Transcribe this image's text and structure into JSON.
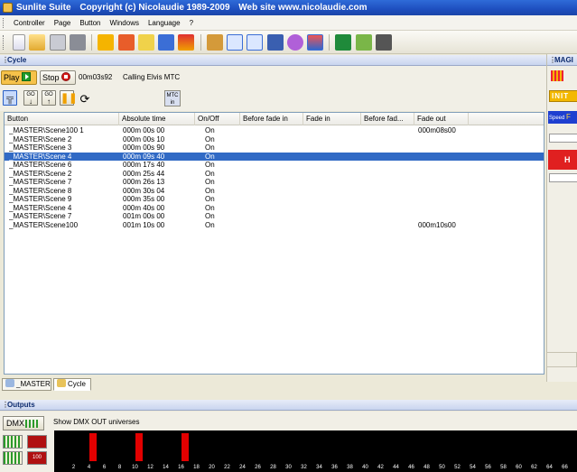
{
  "window": {
    "app_name": "Sunlite Suite",
    "copyright": "Copyright (c) Nicolaudie 1989-2009",
    "website": "Web site www.nicolaudie.com"
  },
  "menu": [
    "Controller",
    "Page",
    "Button",
    "Windows",
    "Language",
    "?"
  ],
  "toolbar_icons": [
    "new-icon",
    "open-icon",
    "save-icon",
    "delete-icon",
    "scene-icon",
    "switch-icon",
    "cycle-icon",
    "bus-icon",
    "color-icon",
    "live-icon",
    "easy-stand-icon",
    "easy-step-icon",
    "monitor-icon",
    "3d-icon",
    "midi-icon",
    "panel-icon",
    "music-icon",
    "tools-icon"
  ],
  "cycle_panel": {
    "title": "Cycle",
    "play_label": "Play",
    "stop_label": "Stop",
    "time": "00m03s92",
    "status": "Calling Elvis MTC",
    "mtc_line1": "MTC",
    "mtc_line2": "in",
    "go_label_1": "GO",
    "go_label_2": "GO"
  },
  "right_panel": {
    "title": "MAGI",
    "init_label": "INIT",
    "speed_label": "Speed",
    "f_label": "F",
    "h_label": "H"
  },
  "table": {
    "columns": [
      "Button",
      "Absolute time",
      "On/Off",
      "Before fade in",
      "Fade in",
      "Before fad...",
      "Fade out"
    ],
    "rows": [
      [
        "_MASTER\\Scene100 1",
        "000m 00s 00",
        "On",
        "",
        "",
        "",
        "000m08s00"
      ],
      [
        "_MASTER\\Scene 2",
        "000m 00s 10",
        "On",
        "",
        "",
        "",
        ""
      ],
      [
        "_MASTER\\Scene 3",
        "000m 00s 90",
        "On",
        "",
        "",
        "",
        ""
      ],
      [
        "_MASTER\\Scene 4",
        "000m 09s 40",
        "On",
        "",
        "",
        "",
        ""
      ],
      [
        "_MASTER\\Scene 6",
        "000m 17s 40",
        "On",
        "",
        "",
        "",
        ""
      ],
      [
        "_MASTER\\Scene 2",
        "000m 25s 44",
        "On",
        "",
        "",
        "",
        ""
      ],
      [
        "_MASTER\\Scene 7",
        "000m 26s 13",
        "On",
        "",
        "",
        "",
        ""
      ],
      [
        "_MASTER\\Scene 8",
        "000m 30s 04",
        "On",
        "",
        "",
        "",
        ""
      ],
      [
        "_MASTER\\Scene 9",
        "000m 35s 00",
        "On",
        "",
        "",
        "",
        ""
      ],
      [
        "_MASTER\\Scene 4",
        "000m 40s 00",
        "On",
        "",
        "",
        "",
        ""
      ],
      [
        "_MASTER\\Scene 7",
        "001m 00s 00",
        "On",
        "",
        "",
        "",
        ""
      ],
      [
        "_MASTER\\Scene100",
        "001m 10s 00",
        "On",
        "",
        "",
        "",
        "000m10s00"
      ]
    ],
    "selected_row": 3
  },
  "tabs": [
    "_MASTER",
    "Cycle"
  ],
  "outputs": {
    "title": "Outputs",
    "dmx_label": "DMX",
    "show_text": "Show DMX OUT universes",
    "side_label": "100",
    "channel_levels": {
      "4": 100,
      "10": 100,
      "16": 100
    },
    "channel_ticks": [
      "2",
      "4",
      "6",
      "8",
      "10",
      "12",
      "14",
      "16",
      "18",
      "20",
      "22",
      "24",
      "26",
      "28",
      "30",
      "32",
      "34",
      "36",
      "38",
      "40",
      "42",
      "44",
      "46",
      "48",
      "50",
      "52",
      "54",
      "56",
      "58",
      "60",
      "62",
      "64",
      "66",
      "68"
    ],
    "colors": {
      "channel_bar": "#e20000",
      "selected_row": "#316ac5"
    }
  }
}
